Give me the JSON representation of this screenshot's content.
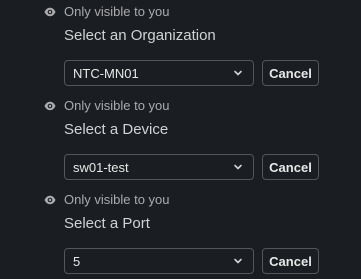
{
  "blocks": [
    {
      "visibility_text": "Only visible to you",
      "prompt": "Select an Organization",
      "selected": "NTC-MN01",
      "cancel_label": "Cancel"
    },
    {
      "visibility_text": "Only visible to you",
      "prompt": "Select a Device",
      "selected": "sw01-test",
      "cancel_label": "Cancel"
    },
    {
      "visibility_text": "Only visible to you",
      "prompt": "Select a Port",
      "selected": "5",
      "cancel_label": "Cancel"
    }
  ],
  "icons": {
    "visibility": "eye-icon",
    "dropdown": "chevron-down-icon"
  },
  "colors": {
    "background": "#1a1d21",
    "border": "#545659",
    "text": "#d1d2d3",
    "muted_text": "#ababad"
  }
}
